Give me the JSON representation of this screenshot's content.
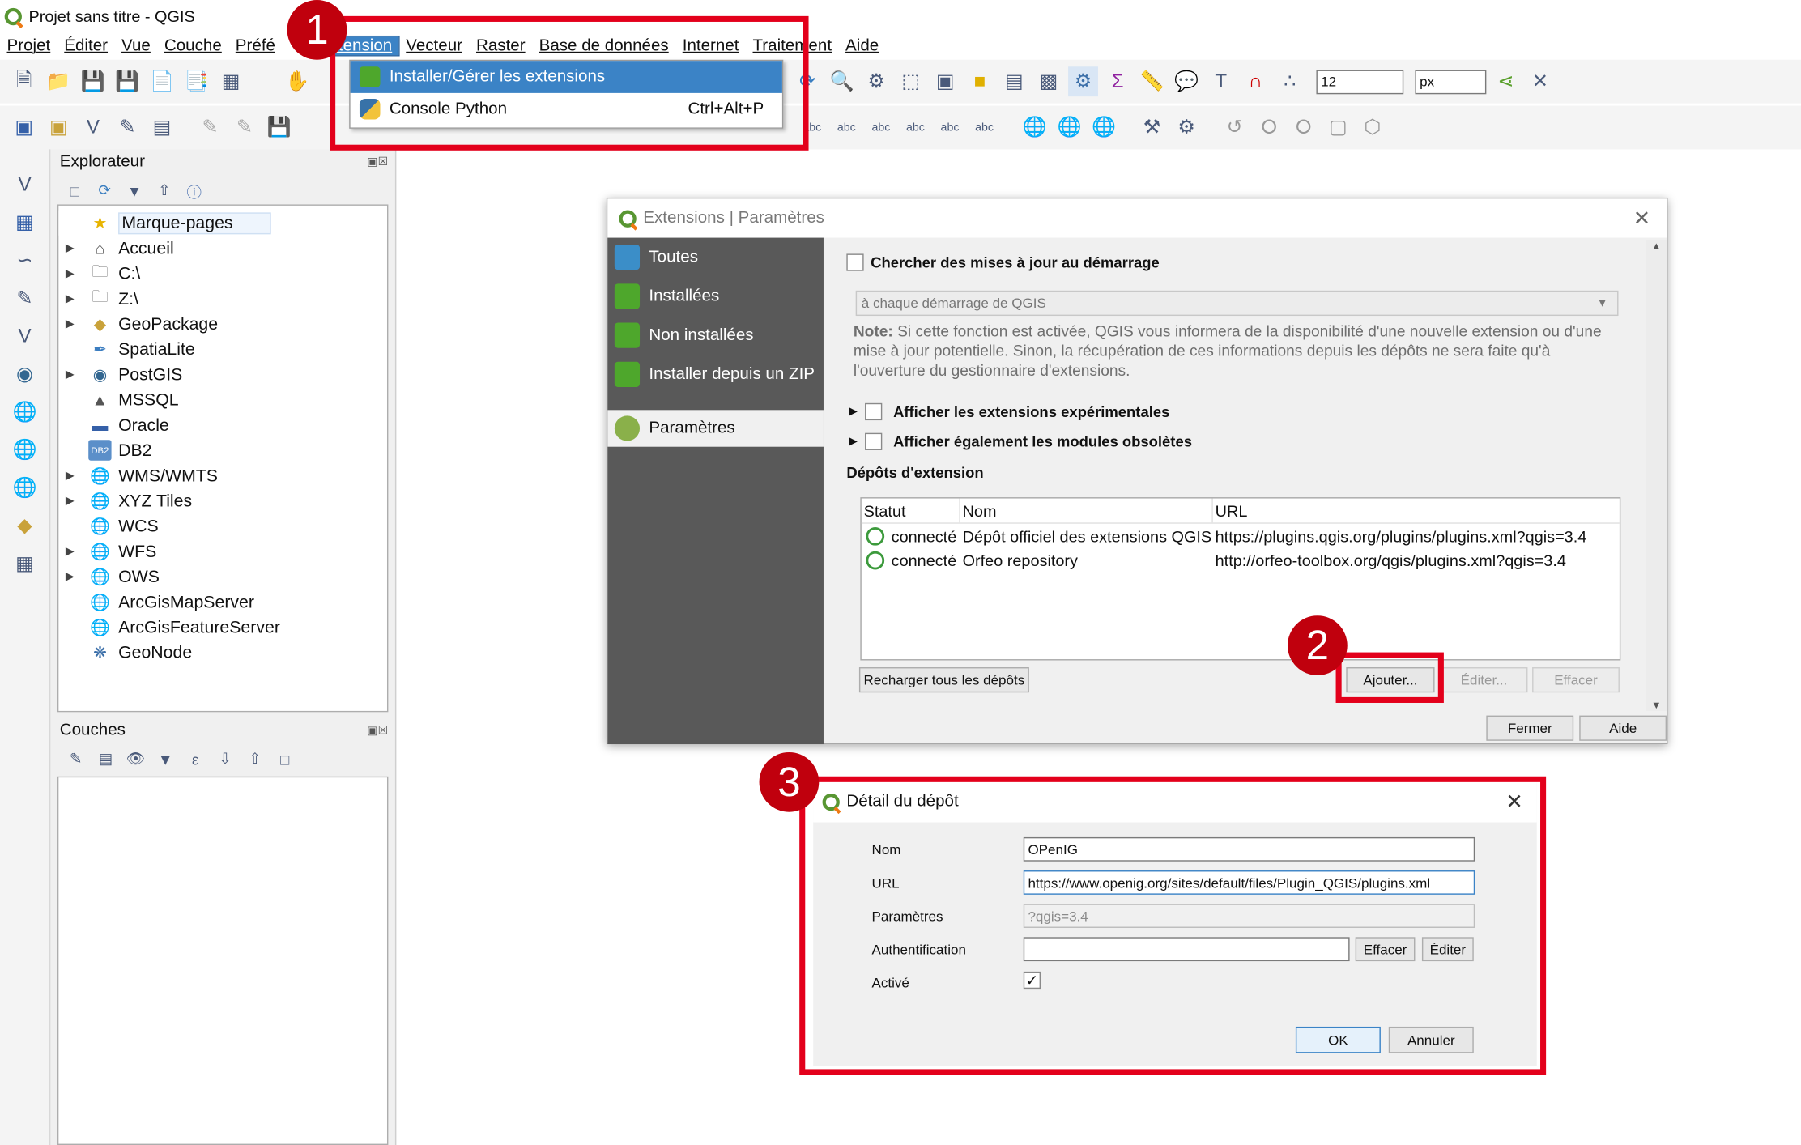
{
  "window": {
    "title": "Projet sans titre - QGIS"
  },
  "menubar": {
    "items": [
      "Projet",
      "Éditer",
      "Vue",
      "Couche",
      "Préfé",
      "Extension",
      "Vecteur",
      "Raster",
      "Base de données",
      "Internet",
      "Traitement",
      "Aide"
    ],
    "active": "Extension"
  },
  "extension_menu": {
    "items": [
      {
        "label": "Installer/Gérer les extensions",
        "shortcut": ""
      },
      {
        "label": "Console Python",
        "shortcut": "Ctrl+Alt+P"
      }
    ]
  },
  "toolbar": {
    "font_size": "12",
    "unit": "px"
  },
  "badges": [
    "1",
    "2",
    "3"
  ],
  "explorer": {
    "title": "Explorateur",
    "items": [
      {
        "label": "Marque-pages",
        "icon": "star-icon",
        "expandable": false
      },
      {
        "label": "Accueil",
        "icon": "home-icon",
        "expandable": true
      },
      {
        "label": "C:\\",
        "icon": "folder-icon",
        "expandable": true
      },
      {
        "label": "Z:\\",
        "icon": "folder-icon",
        "expandable": true
      },
      {
        "label": "GeoPackage",
        "icon": "geopackage-icon",
        "expandable": true
      },
      {
        "label": "SpatiaLite",
        "icon": "spatialite-icon",
        "expandable": false
      },
      {
        "label": "PostGIS",
        "icon": "postgis-icon",
        "expandable": true
      },
      {
        "label": "MSSQL",
        "icon": "mssql-icon",
        "expandable": false
      },
      {
        "label": "Oracle",
        "icon": "oracle-icon",
        "expandable": false
      },
      {
        "label": "DB2",
        "icon": "db2-icon",
        "expandable": false
      },
      {
        "label": "WMS/WMTS",
        "icon": "globe-icon",
        "expandable": true
      },
      {
        "label": "XYZ Tiles",
        "icon": "globe-icon",
        "expandable": true
      },
      {
        "label": "WCS",
        "icon": "globe-icon",
        "expandable": false
      },
      {
        "label": "WFS",
        "icon": "globe-icon",
        "expandable": true
      },
      {
        "label": "OWS",
        "icon": "globe-icon",
        "expandable": true
      },
      {
        "label": "ArcGisMapServer",
        "icon": "globe-icon",
        "expandable": false
      },
      {
        "label": "ArcGisFeatureServer",
        "icon": "globe-icon",
        "expandable": false
      },
      {
        "label": "GeoNode",
        "icon": "geonode-icon",
        "expandable": false
      }
    ]
  },
  "layers": {
    "title": "Couches"
  },
  "plugins_dialog": {
    "title": "Extensions | Paramètres",
    "sidebar": [
      "Toutes",
      "Installées",
      "Non installées",
      "Installer depuis un ZIP"
    ],
    "sidebar_selected": "Paramètres",
    "check_updates_label": "Chercher des mises à jour au démarrage",
    "frequency": "à chaque démarrage de QGIS",
    "note_label": "Note:",
    "note_text": "Si cette fonction est activée, QGIS vous informera de la disponibilité d'une nouvelle extension ou d'une mise à jour potentielle. Sinon, la récupération de ces informations depuis les dépôts ne sera faite qu'à l'ouverture du gestionnaire d'extensions.",
    "experimental_label": "Afficher les extensions expérimentales",
    "deprecated_label": "Afficher également les modules obsolètes",
    "repos_title": "Dépôts d'extension",
    "columns": [
      "Statut",
      "Nom",
      "URL"
    ],
    "repos": [
      {
        "status": "connecté",
        "name": "Dépôt officiel des extensions QGIS",
        "url": "https://plugins.qgis.org/plugins/plugins.xml?qgis=3.4"
      },
      {
        "status": "connecté",
        "name": "Orfeo repository",
        "url": "http://orfeo-toolbox.org/qgis/plugins.xml?qgis=3.4"
      }
    ],
    "reload_btn": "Recharger tous les dépôts",
    "add_btn": "Ajouter...",
    "edit_btn": "Éditer...",
    "delete_btn": "Effacer",
    "close_btn": "Fermer",
    "help_btn": "Aide"
  },
  "repo_dialog": {
    "title": "Détail du dépôt",
    "name_label": "Nom",
    "name_value": "OPenIG",
    "url_label": "URL",
    "url_value": "https://www.openig.org/sites/default/files/Plugin_QGIS/plugins.xml",
    "params_label": "Paramètres",
    "params_value": "?qgis=3.4",
    "auth_label": "Authentification",
    "auth_value": "",
    "auth_clear": "Effacer",
    "auth_edit": "Éditer",
    "enabled_label": "Activé",
    "enabled": true,
    "ok_btn": "OK",
    "cancel_btn": "Annuler"
  },
  "colors": {
    "highlight": "#e3001b",
    "badge": "#c0000d",
    "selection": "#3b83c6",
    "sidebar": "#595959"
  }
}
